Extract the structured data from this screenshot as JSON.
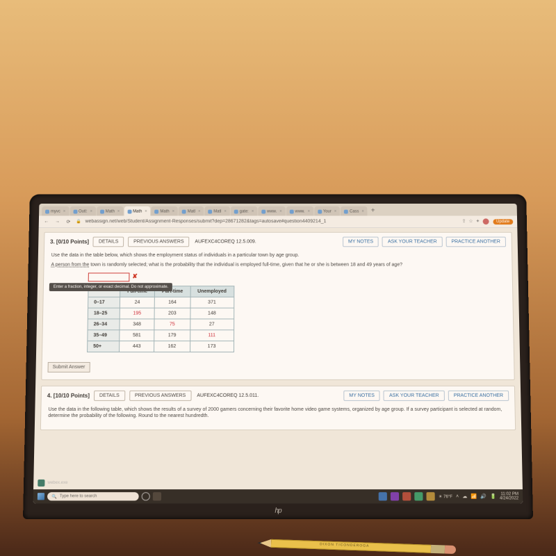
{
  "tabs": [
    {
      "label": "myvc"
    },
    {
      "label": "Outl:"
    },
    {
      "label": "Math"
    },
    {
      "label": "Math",
      "active": true
    },
    {
      "label": "Math"
    },
    {
      "label": "Matl"
    },
    {
      "label": "Matl"
    },
    {
      "label": "gate:"
    },
    {
      "label": "www."
    },
    {
      "label": "www."
    },
    {
      "label": "Your"
    },
    {
      "label": "Cass"
    }
  ],
  "url": "webassign.net/web/Student/Assignment-Responses/submit?dep=28671282&tags=autosave#question4409214_1",
  "update_label": "Update",
  "q3": {
    "number": "3.",
    "points": "[0/10 Points]",
    "details": "DETAILS",
    "prev": "PREVIOUS ANSWERS",
    "ref": "AUFEXC4COREQ 12.5.009.",
    "mynotes": "MY NOTES",
    "ask": "ASK YOUR TEACHER",
    "practice": "PRACTICE ANOTHER",
    "prompt1": "Use the data in the table below, which shows the employment status of individuals in a particular town by age group.",
    "prompt2_lead": "A person from the",
    "prompt2_rest": " town is randomly selected; what is the probability that the individual is employed full-time, given that he or she is between 18 and 49 years of age?",
    "tooltip": "Enter a fraction, integer, or exact decimal. Do not approximate.",
    "headers": [
      "",
      "Full-time",
      "Part-time",
      "Unemployed"
    ],
    "rows": [
      {
        "label": "0–17",
        "c": [
          "24",
          "164",
          "371"
        ],
        "red": []
      },
      {
        "label": "18–25",
        "c": [
          "195",
          "203",
          "148"
        ],
        "red": [
          0
        ]
      },
      {
        "label": "26–34",
        "c": [
          "348",
          "75",
          "27"
        ],
        "red": [
          1
        ]
      },
      {
        "label": "35–49",
        "c": [
          "581",
          "179",
          "111"
        ],
        "red": [
          2
        ]
      },
      {
        "label": "50+",
        "c": [
          "443",
          "162",
          "173"
        ],
        "red": []
      }
    ],
    "submit": "Submit Answer"
  },
  "q4": {
    "number": "4.",
    "points": "[10/10 Points]",
    "details": "DETAILS",
    "prev": "PREVIOUS ANSWERS",
    "ref": "AUFEXC4COREQ 12.5.011.",
    "mynotes": "MY NOTES",
    "ask": "ASK YOUR TEACHER",
    "practice": "PRACTICE ANOTHER",
    "prompt": "Use the data in the following table, which shows the results of a survey of 2000 gamers concerning their favorite home video game systems, organized by age group. If a survey participant is selected at random, determine the probability of the following. Round to the nearest hundredth."
  },
  "taskbar": {
    "search_placeholder": "Type here to search",
    "weather": "76°F",
    "time": "11:02 PM",
    "date": "4/24/2022"
  },
  "webex": "webex.exe",
  "hp": "hp",
  "pencil_text": "DIXON  TICONDEROGA"
}
